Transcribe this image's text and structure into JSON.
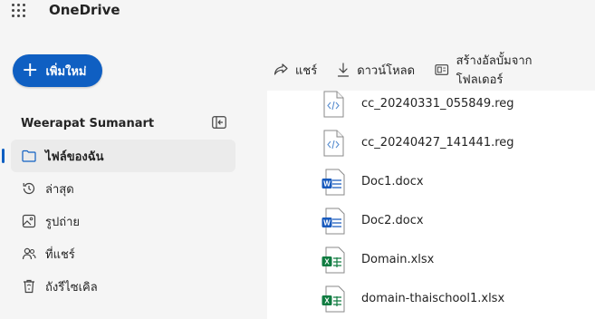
{
  "app": {
    "title": "OneDrive"
  },
  "sidebar": {
    "new_button_label": "เพิ่มใหม่",
    "user_name": "Weerapat Sumanart",
    "items": [
      {
        "label": "ไฟล์ของฉัน",
        "icon": "folder-icon",
        "active": true
      },
      {
        "label": "ล่าสุด",
        "icon": "history-icon",
        "active": false
      },
      {
        "label": "รูปถ่าย",
        "icon": "image-icon",
        "active": false
      },
      {
        "label": "ที่แชร์",
        "icon": "people-icon",
        "active": false
      },
      {
        "label": "ถังรีไซเคิล",
        "icon": "recycle-bin-icon",
        "active": false
      }
    ]
  },
  "toolbar": {
    "share_label": "แชร์",
    "download_label": "ดาวน์โหลด",
    "create_album_label": "สร้างอัลบั้มจากโฟลเดอร์"
  },
  "files": [
    {
      "name": "cc_20240331_055849.reg",
      "type": "code"
    },
    {
      "name": "cc_20240427_141441.reg",
      "type": "code"
    },
    {
      "name": "Doc1.docx",
      "type": "word"
    },
    {
      "name": "Doc2.docx",
      "type": "word"
    },
    {
      "name": "Domain.xlsx",
      "type": "excel"
    },
    {
      "name": "domain-thaischool1.xlsx",
      "type": "excel"
    }
  ],
  "colors": {
    "accent": "#0f5fc2",
    "word": "#185abd",
    "excel": "#107c41",
    "background": "#f5f5f5"
  }
}
